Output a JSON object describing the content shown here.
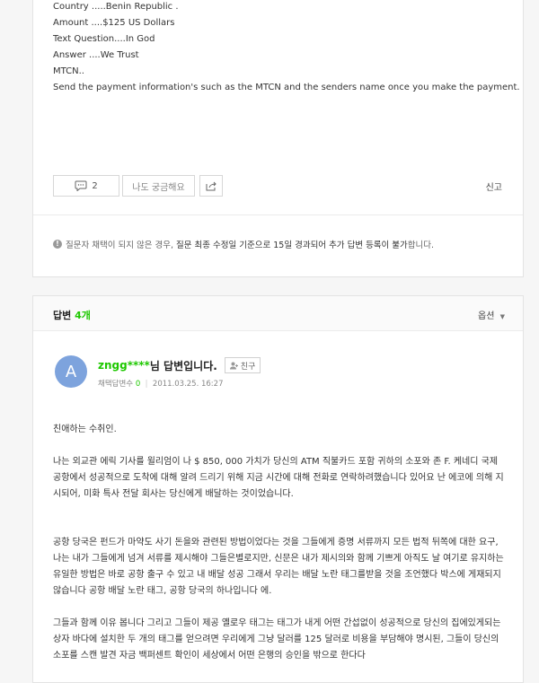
{
  "question": {
    "lines": [
      "Country .....Benin Republic .",
      "Amount ....$125 US Dollars",
      "Text Question....In God",
      "Answer ....We Trust",
      "MTCN..",
      "Send the payment information's such as the MTCN and the senders name once you make the payment."
    ],
    "comment_count": "2",
    "curious_label": "나도 궁금해요",
    "report_label": "신고",
    "notice_prefix": "질문자 채택이 되지 않은 경우,",
    "notice_bold": "질문 최종 수정일 기준으로 15일 경과되어 추가 답변 등록이 불가",
    "notice_suffix": "합니다."
  },
  "answers": {
    "title": "답변",
    "count": "4개",
    "options_label": "옵션",
    "item": {
      "avatar_letter": "A",
      "author": "zngg****",
      "author_suffix": "님 답변입니다.",
      "friend_label": "친구",
      "adopted_label": "채택답변수",
      "adopted_count": "0",
      "date": "2011.03.25. 16:27",
      "paragraphs": [
        "친애하는 수취인.",
        "나는 외교관 에릭 기사를 윌리엄이 나 $ 850, 000 가치가 당신의 ATM 직불카드 포함 귀하의 소포와 존 F. 케네디 국제 공항에서 성공적으로 도착에 대해 알려 드리기 위해 지금 시간에 대해 전화로 연락하려했습니다 있어요 난 에코에 의해 지시되어, 미화 특사 전달 회사는 당신에게 배달하는 것이었습니다.",
        "공항 당국은 펀드가 마약도 사기 돈을와 관련된 방법이었다는 것을 그들에게 증명 서류까지 모든 법적 뒤쪽에 대한 요구, 나는 내가 그들에게 넘겨 서류를 제시해야 그들은별로지만, 신문은 내가 제시의와 함께 기쁘게 아직도 날 여기로 유지하는 유일한 방법은 바로 공항 출구 수 있고 내 배달 성공 그래서 우리는 배달 노란 태그를받을 것을 조언했다 박스에 게재되지 않습니다 공항 배달 노란 태그, 공항 당국의 하나입니다 에.",
        "그들과 함께 이유 봅니다 그리고 그들이 제공 옐로우 태그는 태그가 내게 어떤 간섭없이 성공적으로 당신의 집에있게되는 상자 바다에 설치한 두 개의 태그를 얻으려면 우리에게 그냥 달러를 125 달러로 비용을 부담해야 명시된, 그들이 당신의 소포를 스캔 발견 자금 백퍼센트 확인이 세상에서 어떤 은행의 승인을 밖으로 한다다"
      ]
    }
  },
  "icons": {
    "comment": "speech-bubble-icon",
    "share": "share-icon",
    "info": "info-icon",
    "options_caret": "caret-down-icon",
    "friend": "add-friend-icon"
  },
  "colors": {
    "accent": "#1ec800",
    "avatar_bg": "#7da3dd"
  }
}
